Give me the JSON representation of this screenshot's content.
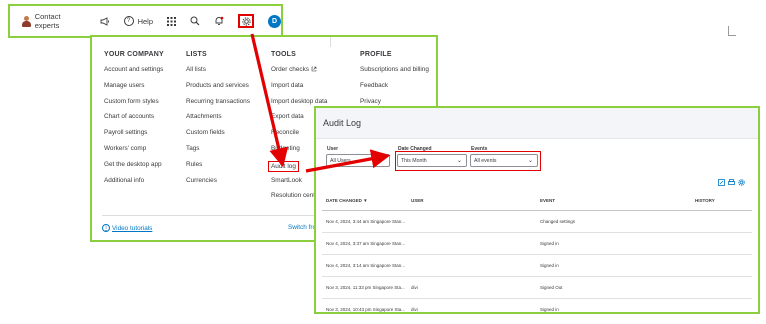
{
  "toolbar": {
    "contact_label": "Contact experts",
    "help_label": "Help",
    "help_glyph": "?",
    "user_initial": "D",
    "icons": [
      "person-icon",
      "megaphone-icon",
      "help-icon",
      "apps-grid-icon",
      "search-icon",
      "notification-bell-icon",
      "gear-icon"
    ]
  },
  "settings_menu": {
    "columns": [
      {
        "heading": "YOUR COMPANY",
        "items": [
          "Account and settings",
          "Manage users",
          "Custom form styles",
          "Chart of accounts",
          "Payroll settings",
          "Workers' comp",
          "Get the desktop app",
          "Additional info"
        ]
      },
      {
        "heading": "LISTS",
        "items": [
          "All lists",
          "Products and services",
          "Recurring transactions",
          "Attachments",
          "Custom fields",
          "Tags",
          "Rules",
          "Currencies"
        ]
      },
      {
        "heading": "TOOLS",
        "items": [
          "Order checks",
          "Import data",
          "Import desktop data",
          "Export data",
          "Reconcile",
          "Budgeting",
          "Audit log",
          "SmartLook",
          "Resolution cent"
        ]
      },
      {
        "heading": "PROFILE",
        "items": [
          "Subscriptions and billing",
          "Feedback",
          "Privacy"
        ]
      }
    ],
    "video_tutorials": "Video tutorials",
    "info_glyph": "i",
    "switch_label": "Switch fro"
  },
  "audit_log": {
    "title": "Audit Log",
    "filters": {
      "user_label": "User",
      "user_value": "All Users",
      "date_label": "Date Changed",
      "date_value": "This Month",
      "events_label": "Events",
      "events_value": "All events"
    },
    "columns": [
      "DATE CHANGED ▼",
      "USER",
      "EVENT",
      "HISTORY"
    ],
    "rows": [
      {
        "date": "Nov 4, 2024, 3:44 am Singapore Stan...",
        "user": "",
        "event": "Changed settings",
        "history": ""
      },
      {
        "date": "Nov 4, 2024, 3:37 am Singapore Stan...",
        "user": "",
        "event": "Signed in",
        "history": ""
      },
      {
        "date": "Nov 4, 2024, 3:14 am Singapore Stan...",
        "user": "",
        "event": "Signed in",
        "history": ""
      },
      {
        "date": "Nov 3, 2024, 11:33 pm Singapore Sta...",
        "user": "divi",
        "event": "Signed Out",
        "history": ""
      },
      {
        "date": "Nov 3, 2024, 10:43 pm Singapore Sta...",
        "user": "divi",
        "event": "Signed in",
        "history": ""
      }
    ],
    "table_icons": [
      "edit-icon",
      "print-icon",
      "settings-icon"
    ]
  },
  "colors": {
    "highlight_border": "#8ccf3e",
    "annotation_red": "#e30000",
    "link_blue": "#0077c5"
  }
}
